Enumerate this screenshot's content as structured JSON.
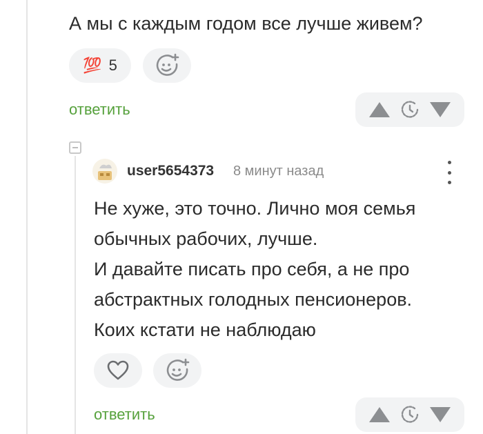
{
  "parent_comment": {
    "text": "А мы с каждым годом все лучше живем?",
    "reaction": {
      "emoji": "💯",
      "count": "5"
    },
    "reply_label": "ответить"
  },
  "reply_comment": {
    "author": "user5654373",
    "timestamp": "8 минут назад",
    "lines": [
      "Не хуже, это точно. Лично моя семья",
      "обычных рабочих, лучше.",
      "И давайте писать про себя, а не про",
      "абстрактных голодных пенсионеров.",
      "Коих кстати не наблюдаю"
    ],
    "reply_label": "ответить"
  },
  "colors": {
    "accent_green": "#56a13c",
    "pill_bg": "#f2f3f4",
    "icon_gray": "#8c8e91"
  },
  "icons": {
    "upvote": "triangle-up-icon",
    "downvote": "triangle-down-icon",
    "save": "clock-icon",
    "add_reaction": "smile-plus-icon",
    "like": "heart-icon",
    "menu": "kebab-icon",
    "collapse": "minus-square-icon"
  }
}
